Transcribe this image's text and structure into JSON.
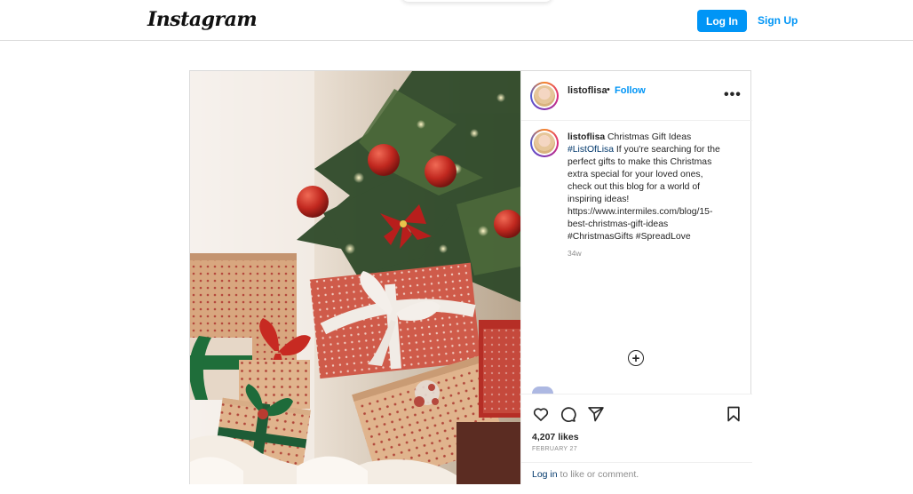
{
  "header": {
    "logo_text": "Instagram",
    "login_label": "Log In",
    "signup_label": "Sign Up"
  },
  "post": {
    "username": "listoflisa",
    "dot": "•",
    "follow_label": "Follow",
    "more_label": "•••",
    "caption": {
      "username": "listoflisa",
      "title": "Christmas Gift Ideas",
      "hashtag1": "#ListOfLisa",
      "line1_rest": "If you're searching for the",
      "line2": "perfect gifts to make this Christmas",
      "line3": "extra special for your loved ones,",
      "line4": "check out this blog for a world of",
      "line5": "inspiring ideas!",
      "line6": "https://www.intermiles.com/blog/15-",
      "line7": "best-christmas-gift-ideas",
      "line8": "#ChristmasGifts #SpreadLove"
    },
    "time": "34w",
    "add_icon": "plus-circle-icon",
    "likes": "4,207 likes",
    "date": "FEBRUARY 27",
    "login_link": "Log in",
    "login_suffix": " to like or comment."
  },
  "colors": {
    "accent": "#0095f6",
    "link": "#00376b",
    "muted": "#8e8e8e",
    "border": "#dbdbdb"
  }
}
